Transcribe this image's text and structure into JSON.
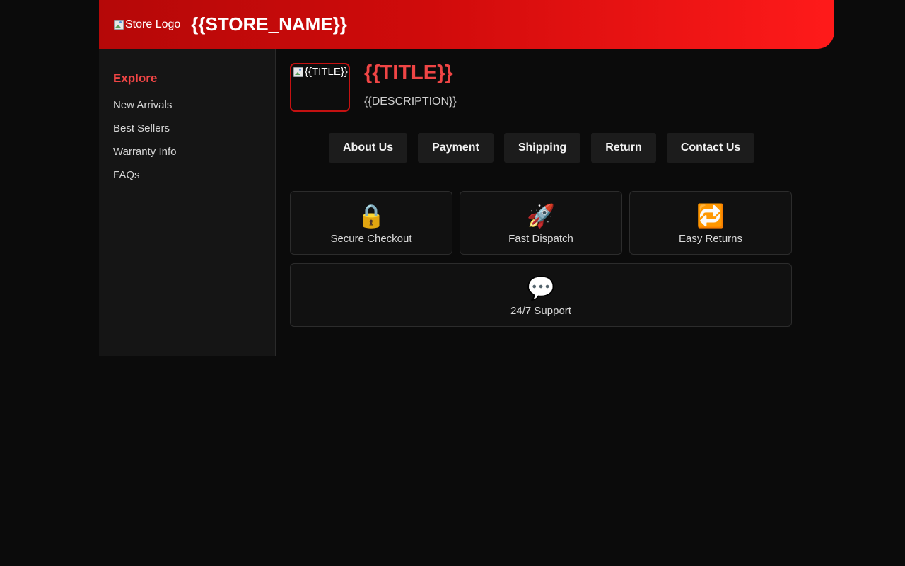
{
  "header": {
    "logo_alt": "Store Logo",
    "store_name": "{{STORE_NAME}}"
  },
  "sidebar": {
    "heading": "Explore",
    "links": [
      {
        "label": "New Arrivals"
      },
      {
        "label": "Best Sellers"
      },
      {
        "label": "Warranty Info"
      },
      {
        "label": "FAQs"
      }
    ]
  },
  "product": {
    "image_alt": "{{TITLE}}",
    "title": "{{TITLE}}",
    "description": "{{DESCRIPTION}}"
  },
  "tabs": [
    {
      "label": "About Us"
    },
    {
      "label": "Payment"
    },
    {
      "label": "Shipping"
    },
    {
      "label": "Return"
    },
    {
      "label": "Contact Us"
    }
  ],
  "features": [
    {
      "icon": "🔒",
      "icon_name": "lock-icon",
      "label": "Secure Checkout"
    },
    {
      "icon": "🚀",
      "icon_name": "rocket-icon",
      "label": "Fast Dispatch"
    },
    {
      "icon": "🔁",
      "icon_name": "repeat-icon",
      "label": "Easy Returns"
    },
    {
      "icon": "💬",
      "icon_name": "speech-bubble-icon",
      "label": "24/7 Support"
    }
  ],
  "colors": {
    "accent": "#ef4545",
    "header_gradient_start": "#b50808",
    "header_gradient_end": "#ff1a1a",
    "background": "#0b0b0b"
  }
}
